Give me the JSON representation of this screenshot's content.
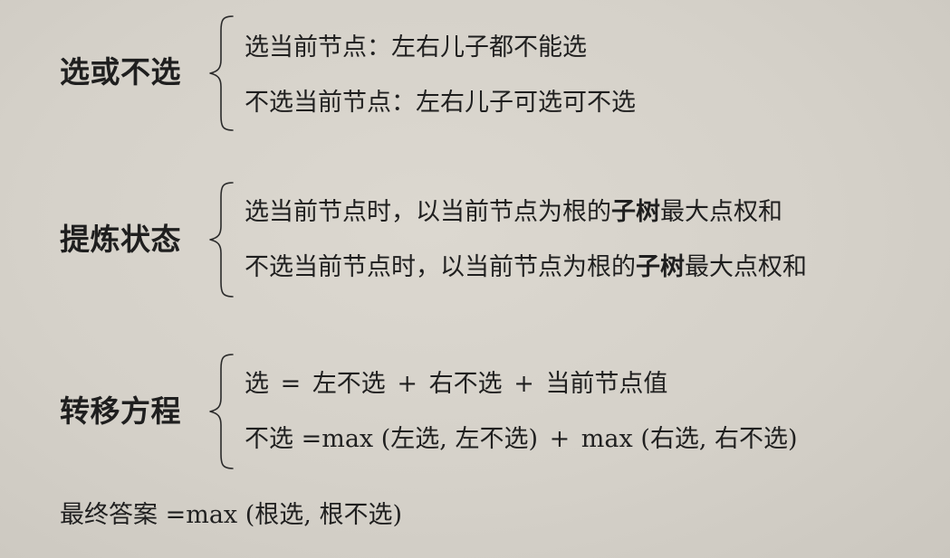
{
  "sections": [
    {
      "label": "选或不选",
      "lines": [
        {
          "text": "选当前节点：左右儿子都不能选"
        },
        {
          "text": "不选当前节点：左右儿子可选可不选"
        }
      ]
    },
    {
      "label": "提炼状态",
      "lines": [
        {
          "pre": "选当前节点时，以当前节点为根的",
          "bold": "子树",
          "post": "最大点权和"
        },
        {
          "pre": "不选当前节点时，以当前节点为根的",
          "bold": "子树",
          "post": "最大点权和"
        }
      ]
    },
    {
      "label": "转移方程",
      "lines": [
        {
          "lhs": "选",
          "eq": "=",
          "t1": "左不选",
          "op1": "+",
          "t2": "右不选",
          "op2": "+",
          "t3": "当前节点值"
        },
        {
          "lhs": "不选",
          "eq": "=max",
          "t1": "(左选, 左不选)",
          "op1": "+",
          "t2": "max",
          "t3": "(右选, 右不选)"
        }
      ]
    }
  ],
  "final": {
    "lhs": "最终答案",
    "eq": "=max",
    "rhs": "(根选, 根不选)"
  }
}
